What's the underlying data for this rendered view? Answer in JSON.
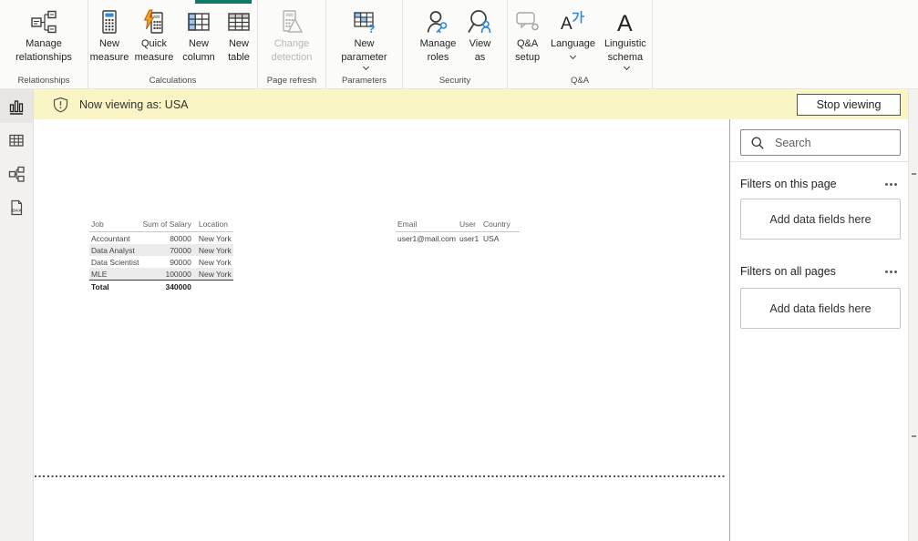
{
  "ribbon": {
    "groups": [
      {
        "label": "Relationships",
        "buttons": [
          {
            "label": "Manage relationships"
          }
        ]
      },
      {
        "label": "Calculations",
        "buttons": [
          {
            "label": "New measure"
          },
          {
            "label": "Quick measure"
          },
          {
            "label": "New column"
          },
          {
            "label": "New table"
          }
        ]
      },
      {
        "label": "Page refresh",
        "buttons": [
          {
            "label": "Change detection",
            "disabled": true
          }
        ]
      },
      {
        "label": "Parameters",
        "buttons": [
          {
            "label": "New parameter",
            "dropdown": true
          }
        ]
      },
      {
        "label": "Security",
        "buttons": [
          {
            "label": "Manage roles"
          },
          {
            "label": "View as"
          }
        ]
      },
      {
        "label": "Q&A",
        "buttons": [
          {
            "label": "Q&A setup"
          },
          {
            "label": "Language",
            "dropdown": true
          },
          {
            "label": "Linguistic schema",
            "dropdown": true
          }
        ]
      }
    ]
  },
  "banner": {
    "message": "Now viewing as: USA",
    "stop_button": "Stop viewing",
    "background": "#faf5c5"
  },
  "sidebar": {
    "items": [
      {
        "name": "report-view",
        "active": true
      },
      {
        "name": "data-view",
        "active": false
      },
      {
        "name": "model-view",
        "active": false
      },
      {
        "name": "dax-query-view",
        "active": false
      }
    ],
    "dax_icon_text": "DAX"
  },
  "canvas": {
    "visuals": [
      {
        "type": "table",
        "columns": [
          "Job",
          "Sum of Salary",
          "Location"
        ],
        "rows": [
          [
            "Accountant",
            "80000",
            "New York"
          ],
          [
            "Data Analyst",
            "70000",
            "New York"
          ],
          [
            "Data Scientist",
            "90000",
            "New York"
          ],
          [
            "MLE",
            "100000",
            "New York"
          ]
        ],
        "total_row": [
          "Total",
          "340000",
          ""
        ]
      },
      {
        "type": "table",
        "columns": [
          "Email",
          "User",
          "Country"
        ],
        "rows": [
          [
            "user1@mail.com",
            "user1",
            "USA"
          ]
        ]
      }
    ]
  },
  "filters_pane": {
    "search_placeholder": "Search",
    "sections": [
      {
        "title": "Filters on this page",
        "drop_area_text": "Add data fields here"
      },
      {
        "title": "Filters on all pages",
        "drop_area_text": "Add data fields here"
      }
    ]
  },
  "icons": {
    "language_a": "A",
    "linguistic_a": "A"
  },
  "colors": {
    "accent_teal": "#117864",
    "accent_blue": "#2b88d8",
    "banner_yellow": "#faf5c5"
  }
}
